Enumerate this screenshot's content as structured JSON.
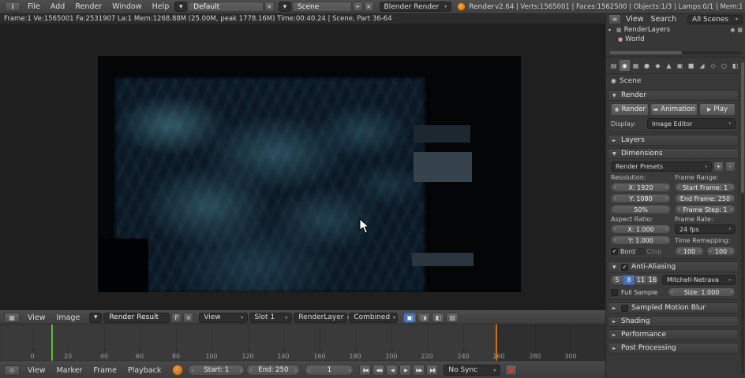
{
  "topbar": {
    "menus": [
      "File",
      "Add",
      "Render",
      "Window",
      "Help"
    ],
    "layout_name": "Default",
    "scene_name": "Scene",
    "engine": "Blender Render",
    "app_label": "Render",
    "stats": "v2.64 | Verts:1565001 | Faces:1562500 | Objects:1/3 | Lamps:0/1 | Mem:1"
  },
  "render_info": "Frame:1 Ve:1565001 Fa:2531907 La:1 Mem:1268.88M (25.00M, peak 1778.16M) Time:00:40.24 | Scene, Part 36-64",
  "outliner": {
    "menu_view": "View",
    "menu_search": "Search",
    "scope": "All Scenes",
    "item_renderlayers": "RenderLayers",
    "item_world": "World"
  },
  "properties": {
    "context_label": "Scene",
    "tab_icons": [
      "▤",
      "◉",
      "▦",
      "●",
      "◆",
      "▲",
      "▣",
      "■",
      "◢",
      "◇",
      "○",
      "◧"
    ],
    "panels": {
      "render": "Render",
      "layers": "Layers",
      "dimensions": "Dimensions",
      "antialiasing": "Anti-Aliasing",
      "motion_blur": "Sampled Motion Blur",
      "shading": "Shading",
      "performance": "Performance",
      "post": "Post Processing"
    },
    "render": {
      "render_btn": "Render",
      "animation_btn": "Animation",
      "play_btn": "Play",
      "display_label": "Display:",
      "display_value": "Image Editor"
    },
    "dimensions": {
      "presets": "Render Presets",
      "add": "+",
      "remove": "-",
      "resolution_label": "Resolution:",
      "res_x": "X: 1920",
      "res_y": "Y: 1080",
      "res_pct": "50%",
      "frame_range_label": "Frame Range:",
      "start_frame": "Start Frame: 1",
      "end_frame": "End Frame: 250",
      "frame_step": "Frame Step: 1",
      "aspect_label": "Aspect Ratio:",
      "aspect_x": "X: 1.000",
      "aspect_y": "Y: 1.000",
      "framerate_label": "Frame Rate:",
      "framerate": "24 fps",
      "remap_label": "Time Remapping:",
      "remap_old": "100",
      "remap_new": "100",
      "border_label": "Bord",
      "crop_label": "Crop"
    },
    "antialiasing": {
      "samples": [
        "5",
        "8",
        "11",
        "16"
      ],
      "selected_sample": "8",
      "filter": "Mitchell-Netrava",
      "full_sample_label": "Full Sample",
      "size": "Size: 1.000"
    }
  },
  "image_editor": {
    "menu_view": "View",
    "menu_image": "Image",
    "datablock": "Render Result",
    "fake_user": "F",
    "view_mode": "View",
    "slot": "Slot 1",
    "layer": "RenderLayer",
    "pass": "Combined"
  },
  "timeline": {
    "ticks": [
      "0",
      "20",
      "40",
      "60",
      "80",
      "100",
      "120",
      "140",
      "160",
      "180",
      "200",
      "220",
      "240",
      "260",
      "280",
      "300"
    ],
    "menu_view": "View",
    "menu_marker": "Marker",
    "menu_frame": "Frame",
    "menu_playback": "Playback",
    "start_field": "Start: 1",
    "end_field": "End: 250",
    "current_frame": "1",
    "sync_mode": "No Sync"
  },
  "icons": {
    "info": "ℹ",
    "image_editor": "▦",
    "outliner": "≡",
    "timeline_clock": "⊙",
    "browse": "▾",
    "menu_arrow": "▾",
    "panel_open": "▼",
    "panel_closed": "►",
    "add": "+",
    "unlink": "×",
    "check": "✓",
    "camera": "◉",
    "world": "●",
    "renderlayer": "▦",
    "clapper": "▬",
    "play": "▶",
    "play_rev": "◀",
    "jump_start": "▮◀",
    "prev_key": "◀◀",
    "next_key": "▶▶",
    "jump_end": "▶▮",
    "disclosure": "▾"
  },
  "colors": {
    "accent_blue": "#4a71b4",
    "playhead_green": "#6ab240",
    "endframe_orange": "#c07122",
    "record_red": "#c14034",
    "caustic_teal": "#5fa8c0"
  }
}
